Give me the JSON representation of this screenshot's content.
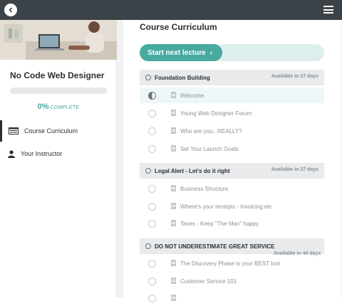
{
  "sidebar": {
    "course_title": "No Code Web Designer",
    "progress": {
      "percent_text": "0%",
      "label": "COMPLETE",
      "fraction": 0
    },
    "nav": [
      {
        "label": "Course Curriculum",
        "icon": "curriculum-icon",
        "active": true
      },
      {
        "label": "Your Instructor",
        "icon": "user-icon",
        "active": false
      }
    ]
  },
  "main": {
    "title": "Course Curriculum",
    "start_button": "Start next lecture",
    "sections": [
      {
        "title": "Foundation Building",
        "availability": "Available in 37 days",
        "lectures": [
          {
            "title": "Welcome",
            "status": "in-progress"
          },
          {
            "title": "Young Web Designer Forum",
            "status": "not-started"
          },
          {
            "title": "Who are you...REALLY?",
            "status": "not-started"
          },
          {
            "title": "Set Your Launch Goals",
            "status": "not-started"
          }
        ]
      },
      {
        "title": "Legal Alert - Let's do it right",
        "availability": "Available in 37 days",
        "lectures": [
          {
            "title": "Business Structure",
            "status": "not-started"
          },
          {
            "title": "Where's your receipts - Invoicing etc",
            "status": "not-started"
          },
          {
            "title": "Taxes - Keep \"The Man\" happy",
            "status": "not-started"
          }
        ]
      },
      {
        "title": "DO NOT UNDERESTIMATE GREAT SERVICE",
        "availability": "Available in 44 days",
        "lectures": [
          {
            "title": "The Discovery Phase is your BEST tool",
            "status": "not-started"
          },
          {
            "title": "Customer Service 101",
            "status": "not-started"
          }
        ]
      }
    ]
  },
  "colors": {
    "accent": "#48aa9f",
    "topbar": "#3c4348",
    "section_bg": "#e8eaeb"
  }
}
